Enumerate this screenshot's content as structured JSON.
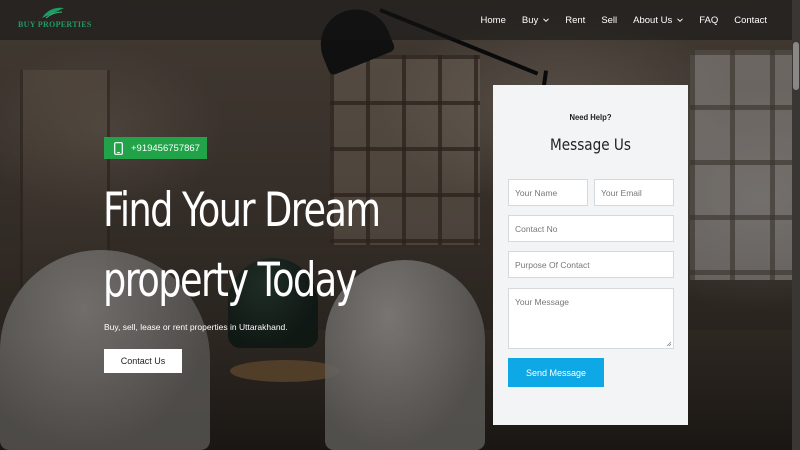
{
  "brand": {
    "name": "BUY PROPERTIES",
    "color": "#1f9b63"
  },
  "nav": {
    "items": [
      {
        "label": "Home",
        "dropdown": false
      },
      {
        "label": "Buy",
        "dropdown": true
      },
      {
        "label": "Rent",
        "dropdown": false
      },
      {
        "label": "Sell",
        "dropdown": false
      },
      {
        "label": "About Us",
        "dropdown": true
      },
      {
        "label": "FAQ",
        "dropdown": false
      },
      {
        "label": "Contact",
        "dropdown": false
      }
    ]
  },
  "hero": {
    "phone": "+919456757867",
    "phone_icon": "mobile-phone-icon",
    "title_line1": "Find Your Dream",
    "title_line2": "property Today",
    "subtitle": "Buy, sell, lease or rent properties in Uttarakhand.",
    "cta_label": "Contact Us"
  },
  "form": {
    "eyebrow": "Need Help?",
    "title": "Message Us",
    "name_placeholder": "Your Name",
    "email_placeholder": "Your Email",
    "contact_placeholder": "Contact No",
    "purpose_placeholder": "Purpose Of Contact",
    "message_placeholder": "Your Message",
    "submit_label": "Send Message"
  },
  "colors": {
    "phone_badge": "#22a34a",
    "submit_button": "#0fa8e6",
    "card_bg": "#f3f4f5"
  }
}
